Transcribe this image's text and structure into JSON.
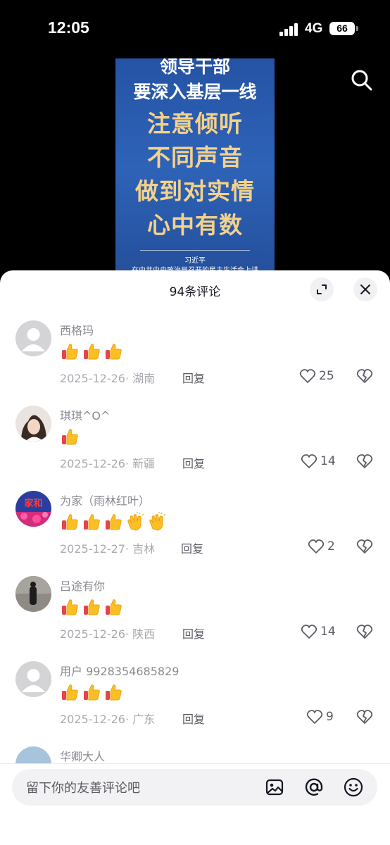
{
  "status_bar": {
    "time": "12:05",
    "network": "4G",
    "battery": "66"
  },
  "video": {
    "poster_lines": [
      "领导干部",
      "要深入基层一线",
      "注意倾听",
      "不同声音",
      "做到对实情",
      "心中有数"
    ],
    "poster_author": "习近平",
    "poster_source": "在中共中央政治局召开的民主生活会上讲"
  },
  "sheet": {
    "title": "94条评论"
  },
  "comments": [
    {
      "username": "西格玛",
      "emojis": [
        "thumbs-up",
        "thumbs-up",
        "thumbs-up"
      ],
      "meta": "2025-12-26· 湖南",
      "reply": "回复",
      "likes": "25"
    },
    {
      "username": "琪琪^O^",
      "emojis": [
        "thumbs-up"
      ],
      "meta": "2025-12-26· 新疆",
      "reply": "回复",
      "likes": "14"
    },
    {
      "username": "为家（雨林红叶）",
      "emojis": [
        "thumbs-up",
        "thumbs-up",
        "thumbs-up",
        "clapping-hands",
        "clapping-hands"
      ],
      "meta": "2025-12-27· 吉林",
      "reply": "回复",
      "likes": "2"
    },
    {
      "username": "吕途有你",
      "emojis": [
        "thumbs-up",
        "thumbs-up",
        "thumbs-up"
      ],
      "meta": "2025-12-26· 陕西",
      "reply": "回复",
      "likes": "14"
    },
    {
      "username": "用户 9928354685829",
      "emojis": [
        "thumbs-up",
        "thumbs-up",
        "thumbs-up"
      ],
      "meta": "2025-12-26· 广东",
      "reply": "回复",
      "likes": "9"
    },
    {
      "username": "华卿大人",
      "emojis": [],
      "meta": "",
      "reply": "",
      "likes": ""
    }
  ],
  "input": {
    "placeholder": "留下你的友善评论吧"
  },
  "colors": {
    "poster_blue": "#2e63b8",
    "poster_gold": "#f4d28a",
    "muted_text": "#8a8b91"
  }
}
